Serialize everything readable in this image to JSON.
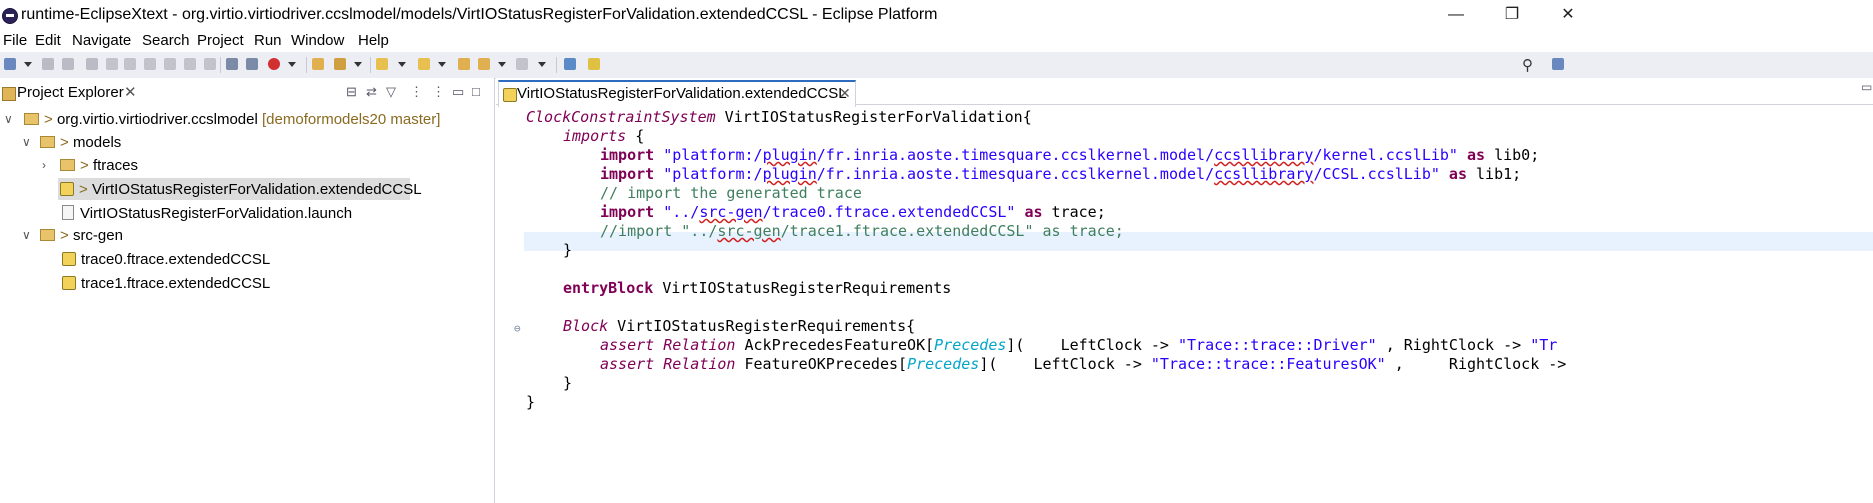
{
  "window": {
    "title": "runtime-EclipseXtext - org.virtio.virtiodriver.ccslmodel/models/VirtIOStatusRegisterForValidation.extendedCCSL - Eclipse Platform",
    "minimize": "—",
    "restore": "❐",
    "close": "✕"
  },
  "menu": [
    "File",
    "Edit",
    "Navigate",
    "Search",
    "Project",
    "Run",
    "Window",
    "Help"
  ],
  "explorer": {
    "tab_label": "Project Explorer",
    "tab_close": "✕",
    "tree": {
      "project_name": "org.virtio.virtiodriver.ccslmodel",
      "project_decor": "[demoformodels20 master]",
      "models_folder": "models",
      "ftraces_folder": "ftraces",
      "selected_file": "VirtIOStatusRegisterForValidation.extendedCCSL",
      "launch_file": "VirtIOStatusRegisterForValidation.launch",
      "srcgen_folder": "src-gen",
      "trace0": "trace0.ftrace.extendedCCSL",
      "trace1": "trace1.ftrace.extendedCCSL",
      "vcs_prefix": ">"
    }
  },
  "editor": {
    "tab_label": "VirtIOStatusRegisterForValidation.extendedCCSL",
    "tab_close": "✕",
    "code": {
      "l1_kw": "ClockConstraintSystem",
      "l1_rest": " VirtIOStatusRegisterForValidation{",
      "l2_kw": "imports",
      "l2_rest": " {",
      "import_kw": "import",
      "as_kw": "as",
      "l3_str_a": "\"platform:/",
      "l3_plugin": "plugin",
      "l3_str_b": "/fr.inria.aoste.timesquare.ccslkernel.model/",
      "l3_lib": "ccsllibrary",
      "l3_str_c": "/kernel.ccslLib\"",
      "l3_alias": " lib0;",
      "l4_str_c": "/CCSL.ccslLib\"",
      "l4_alias": " lib1;",
      "l5_comment": "// import the generated trace",
      "l6_str_a": "\"../",
      "l6_srcgen": "src-gen",
      "l6_str_b": "/trace0.ftrace.extendedCCSL\"",
      "l6_alias": " trace;",
      "l7_comment_a": "//import \"../",
      "l7_comment_b": "/trace1.ftrace.extendedCCSL\" as trace;",
      "close_brace": "}",
      "entry_kw": "entryBlock",
      "entry_name": " VirtIOStatusRegisterRequirements",
      "block_kw": "Block",
      "block_name": " VirtIOStatusRegisterRequirements{",
      "assert_kw": "assert",
      "relation_kw": "Relation",
      "precedes": "Precedes",
      "r1_name": " AckPrecedesFeatureOK[",
      "r1_args": "](    LeftClock -> ",
      "r1_left": "\"Trace::trace::Driver\"",
      "r1_right_label": " , RightClock -> ",
      "r1_right": "\"Tr",
      "r2_name": " FeatureOKPrecedes[",
      "r2_args": "](    LeftClock -> ",
      "r2_left": "\"Trace::trace::FeaturesOK\"",
      "r2_right_label": " ,     RightClock ->",
      "final_brace": "}"
    }
  }
}
